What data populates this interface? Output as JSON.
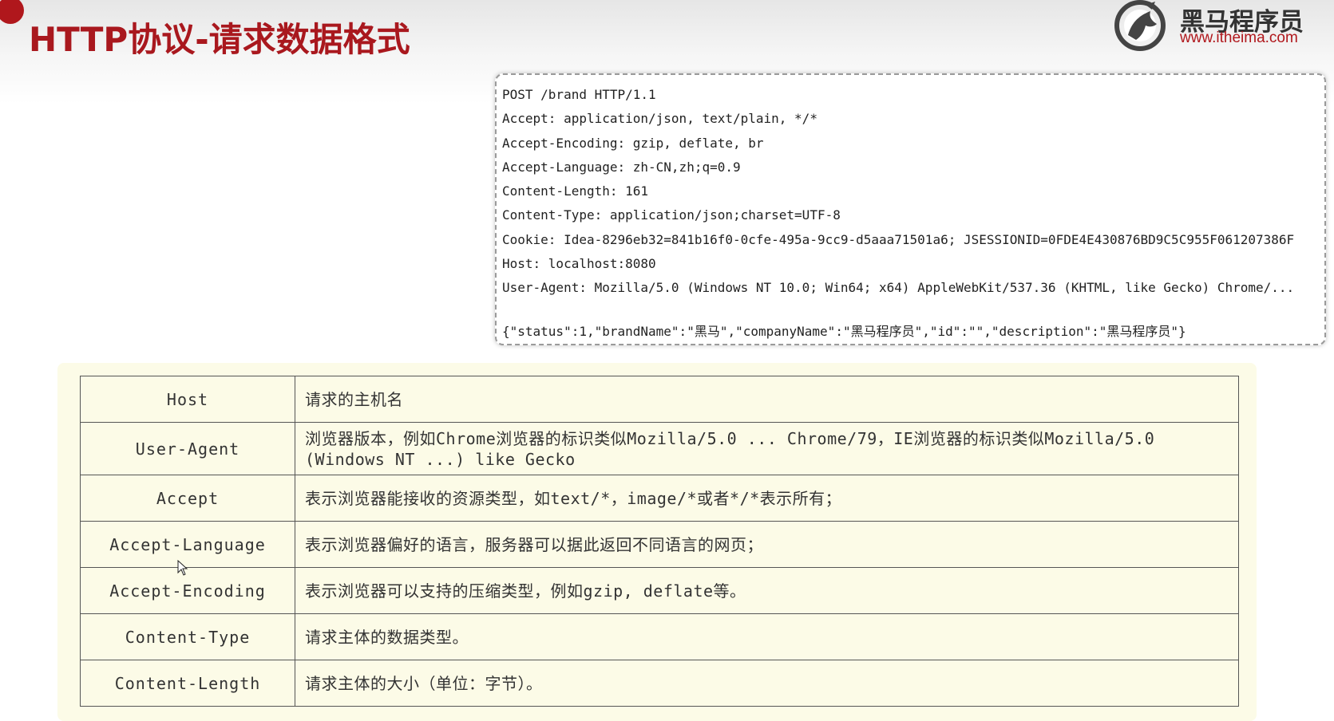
{
  "slide": {
    "title": "HTTP协议-请求数据格式"
  },
  "logo": {
    "name": "黑马程序员",
    "url": "www.itheima.com"
  },
  "request": {
    "lines": [
      "POST /brand HTTP/1.1",
      "Accept: application/json, text/plain, */*",
      "Accept-Encoding: gzip, deflate, br",
      "Accept-Language: zh-CN,zh;q=0.9",
      "Content-Length: 161",
      "Content-Type: application/json;charset=UTF-8",
      "Cookie: Idea-8296eb32=841b16f0-0cfe-495a-9cc9-d5aaa71501a6; JSESSIONID=0FDE4E430876BD9C5C955F061207386F",
      "Host: localhost:8080",
      "User-Agent: Mozilla/5.0 (Windows NT 10.0; Win64; x64) AppleWebKit/537.36 (KHTML, like Gecko) Chrome/...",
      "",
      "{\"status\":1,\"brandName\":\"黑马\",\"companyName\":\"黑马程序员\",\"id\":\"\",\"description\":\"黑马程序员\"}"
    ]
  },
  "header_table": {
    "rows": [
      {
        "name": "Host",
        "description": "请求的主机名"
      },
      {
        "name": "User-Agent",
        "description": "浏览器版本，例如Chrome浏览器的标识类似Mozilla/5.0 ... Chrome/79，IE浏览器的标识类似Mozilla/5.0 (Windows NT ...) like Gecko"
      },
      {
        "name": "Accept",
        "description": "表示浏览器能接收的资源类型，如text/*，image/*或者*/*表示所有；"
      },
      {
        "name": "Accept-Language",
        "description": "表示浏览器偏好的语言，服务器可以据此返回不同语言的网页；"
      },
      {
        "name": "Accept-Encoding",
        "description": "表示浏览器可以支持的压缩类型，例如gzip, deflate等。"
      },
      {
        "name": "Content-Type",
        "description": "请求主体的数据类型。"
      },
      {
        "name": "Content-Length",
        "description": "请求主体的大小（单位：字节）。"
      }
    ]
  },
  "colors": {
    "title_red": "#a9181e",
    "panel_yellow": "#fcfbe7",
    "border": "#555555"
  },
  "icons": [
    "logo-horse-icon",
    "mouse-cursor-icon"
  ]
}
